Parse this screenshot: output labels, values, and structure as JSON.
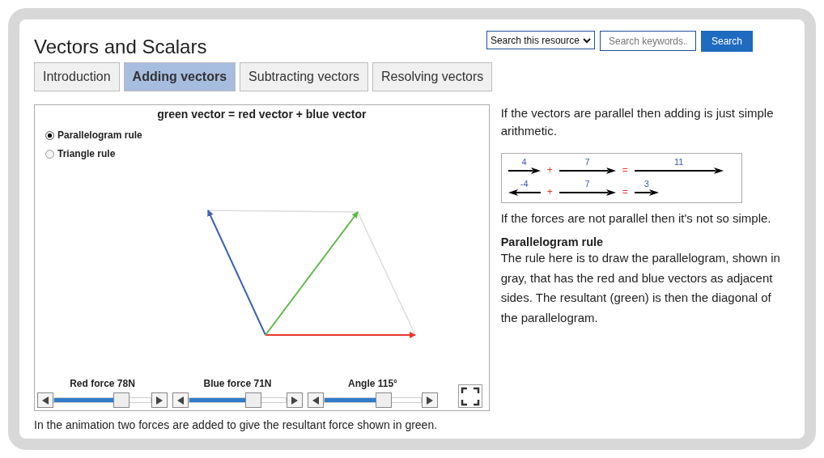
{
  "page_title": "Vectors and Scalars",
  "search": {
    "scope": "Search this resource",
    "placeholder": "Search keywords..",
    "button": "Search"
  },
  "tabs": [
    {
      "label": "Introduction",
      "selected": false
    },
    {
      "label": "Adding vectors",
      "selected": true
    },
    {
      "label": "Subtracting vectors",
      "selected": false
    },
    {
      "label": "Resolving vectors",
      "selected": false
    }
  ],
  "simulation": {
    "title": "green vector = red vector + blue vector",
    "rules": [
      {
        "label": "Parallelogram rule",
        "selected": true
      },
      {
        "label": "Triangle rule",
        "selected": false
      }
    ],
    "sliders": [
      {
        "label": "Red force 78N",
        "level": 0.73
      },
      {
        "label": "Blue force 71N",
        "level": 0.69
      },
      {
        "label": "Angle 115°",
        "level": 0.63
      }
    ]
  },
  "caption": "In the animation two forces are added to give the resultant force shown in green.",
  "explanation": {
    "intro": "If the vectors are parallel then adding is just simple arithmetic.",
    "sums": [
      [
        {
          "kind": "arrow",
          "label": "4"
        },
        {
          "kind": "operator",
          "label": "+"
        },
        {
          "kind": "arrow",
          "label": "7"
        },
        {
          "kind": "operator",
          "label": "="
        },
        {
          "kind": "arrow",
          "label": "11"
        }
      ],
      [
        {
          "kind": "arrow",
          "label": "-4"
        },
        {
          "kind": "operator",
          "label": "+"
        },
        {
          "kind": "arrow",
          "label": "7"
        },
        {
          "kind": "operator",
          "label": "="
        },
        {
          "kind": "arrow",
          "label": "3"
        }
      ]
    ],
    "note": "If the forces are not parallel then it's not so simple.",
    "heading": "Parallelogram rule",
    "body": "The rule here is to draw the parallelogram, shown in gray, that has the red and blue vectors as adjacent sides. The resultant (green) is then the diagonal of the parallelogram."
  }
}
